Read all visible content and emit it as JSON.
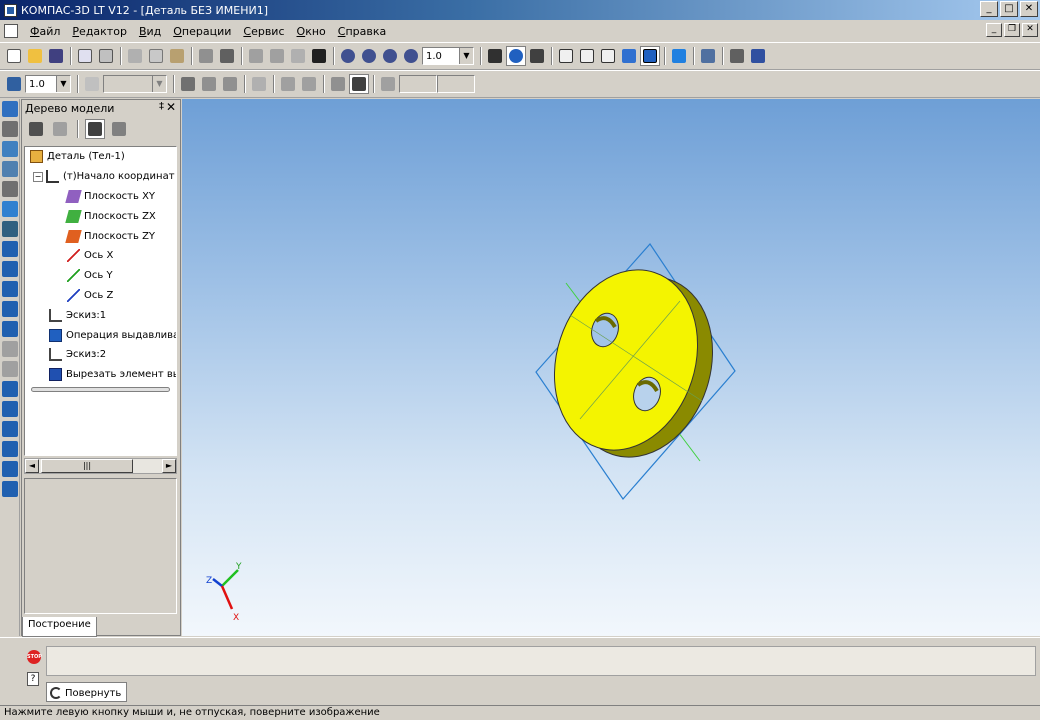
{
  "window": {
    "title": "КОМПАС-3D LT V12 - [Деталь БЕЗ ИМЕНИ1]",
    "minimize": "_",
    "maximize": "□",
    "close": "✕"
  },
  "menu": {
    "items": [
      "Файл",
      "Редактор",
      "Вид",
      "Операции",
      "Сервис",
      "Окно",
      "Справка"
    ]
  },
  "toolbar1": {
    "zoom_value": "1.0"
  },
  "toolbar2": {
    "step_value": "1.0"
  },
  "tree": {
    "title": "Дерево модели",
    "pin": "‡",
    "close": "✕",
    "items": [
      {
        "label": "Деталь (Тел-1)",
        "icon": "part-icon"
      },
      {
        "label": "(т)Начало координат",
        "icon": "origin-icon"
      },
      {
        "label": "Плоскость XY",
        "icon": "plane-xy-icon"
      },
      {
        "label": "Плоскость ZX",
        "icon": "plane-zx-icon"
      },
      {
        "label": "Плоскость ZY",
        "icon": "plane-zy-icon"
      },
      {
        "label": "Ось X",
        "icon": "axis-x-icon"
      },
      {
        "label": "Ось Y",
        "icon": "axis-y-icon"
      },
      {
        "label": "Ось Z",
        "icon": "axis-z-icon"
      },
      {
        "label": "Эскиз:1",
        "icon": "sketch-icon"
      },
      {
        "label": "Операция выдавливания",
        "icon": "extrude-icon"
      },
      {
        "label": "Эскиз:2",
        "icon": "sketch-icon"
      },
      {
        "label": "Вырезать элемент выдав.",
        "icon": "cut-extrude-icon"
      }
    ],
    "tab_label": "Построение"
  },
  "axes": {
    "x": "X",
    "y": "Y",
    "z": "Z"
  },
  "command": {
    "stop_label": "STOP",
    "help_label": "?",
    "tab_label": "Повернуть"
  },
  "status": {
    "text": "Нажмите левую кнопку мыши и, не отпуская, поверните изображение"
  },
  "colors": {
    "part_face": "#f4f400",
    "part_side": "#8a8a00",
    "frame": "#2a7fd0",
    "axis_x": "#e01010",
    "axis_y": "#20c020",
    "axis_z": "#1040d0"
  }
}
